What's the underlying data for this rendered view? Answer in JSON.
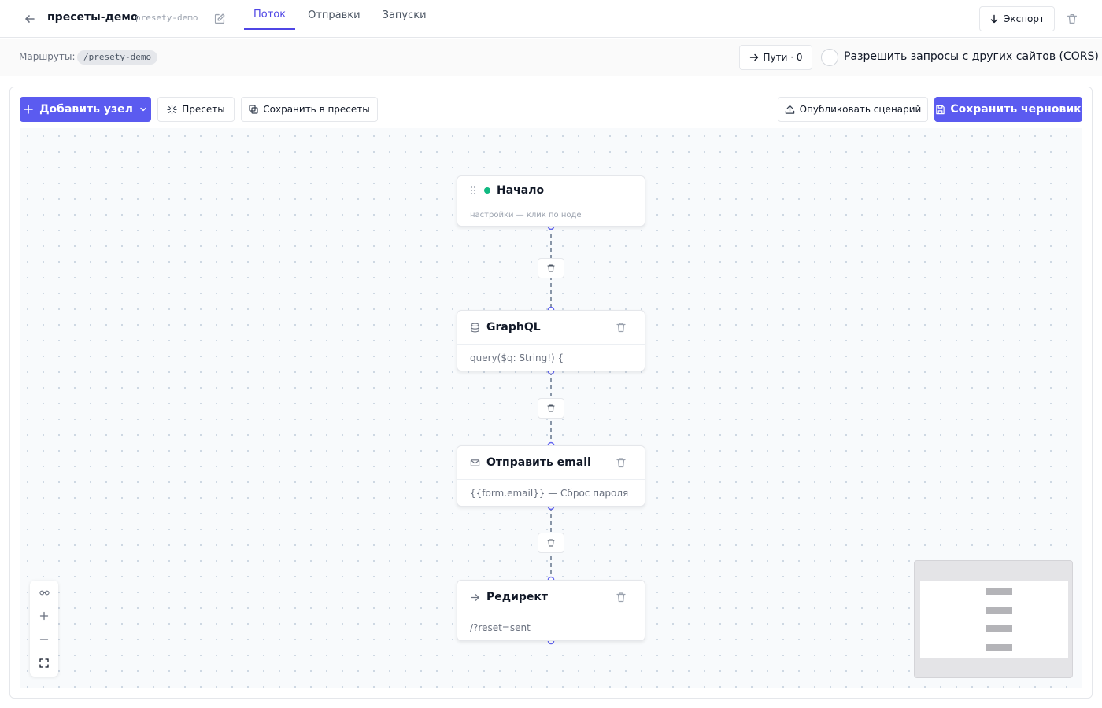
{
  "header": {
    "title": "пресеты-демо",
    "slug": "presety-demo",
    "tabs": [
      {
        "label": "Поток",
        "active": true
      },
      {
        "label": "Отправки",
        "active": false
      },
      {
        "label": "Запуски",
        "active": false
      }
    ],
    "export_label": "Экспорт"
  },
  "routes": {
    "label": "Маршруты:",
    "route": "/presety-demo",
    "paths_label": "Пути · 0",
    "cors_label": "Разрешить запросы с других сайтов (CORS)",
    "cors_enabled": false
  },
  "toolbar": {
    "add_node_label": "Добавить узел",
    "presets_label": "Пресеты",
    "save_presets_label": "Сохранить в пресеты",
    "publish_label": "Опубликовать сценарий",
    "save_draft_label": "Сохранить черновик"
  },
  "nodes": [
    {
      "title": "Начало",
      "subtitle": "настройки — клик по ноде",
      "icon": "drag-handle-icon",
      "status": "active"
    },
    {
      "title": "GraphQL",
      "subtitle": "query($q: String!) {",
      "icon": "database-icon"
    },
    {
      "title": "Отправить email",
      "subtitle": "{{form.email}} — Сброс пароля",
      "icon": "mail-icon"
    },
    {
      "title": "Редирект",
      "subtitle": "/?reset=sent",
      "icon": "arrow-right-icon"
    }
  ],
  "colors": {
    "accent": "#5b5bf0",
    "status_active": "#10b981",
    "edge": "#6366f1"
  }
}
